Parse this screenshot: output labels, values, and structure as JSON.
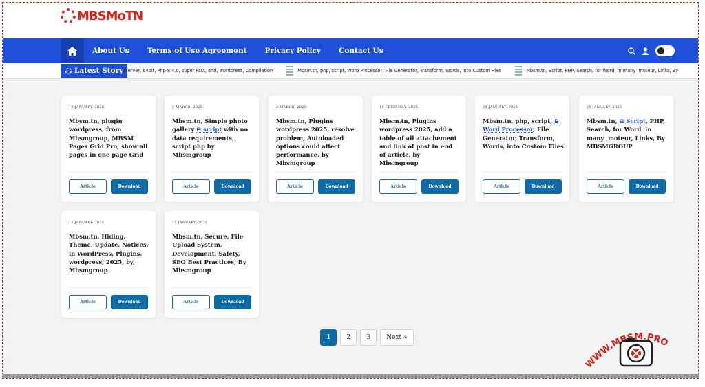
{
  "logo": {
    "text": "MBSMoTN"
  },
  "nav": {
    "links": [
      "About Us",
      "Terms of Use Agreement",
      "Privacy Policy",
      "Contact Us"
    ]
  },
  "ticker": {
    "label": "Latest Story",
    "items": [
      "pserver, 64bit, Php 8.4.0, super Fast, and, wordpress, Compilation",
      "Mbsm.tn, php, script, Word Processor, File Generator, Transform, Words, into Custom Files",
      "Mbsm.tn, Script, PHP, Search, for Word, in many ,moteur, Links, By MBSMGROUP"
    ]
  },
  "cards": [
    {
      "date": "19 JANUARY- 2026",
      "title": "Mbsm.tn, plugin wordpress, from Mbsmgroup, MBSM Pages Grid Pro, show all pages in one page Grid",
      "article": "Article",
      "download": "Download"
    },
    {
      "date": "2 MARCH- 2025",
      "title_a": "Mbsm.tn, Simple photo gallery ",
      "title_hl": "script",
      "title_b": " with no data requirements, script php by Mbsmgroup",
      "article": "Article",
      "download": "Download"
    },
    {
      "date": "2 MARCH- 2025",
      "title": "Mbsm.tn, Plugins wordpress 2025, resolve problem, Autoloaded options could affect performance, by Mbsmgroup",
      "article": "Article",
      "download": "Download"
    },
    {
      "date": "19 FEBRUARY- 2025",
      "title": "Mbsm.tn, Plugins wordpress 2025, add a table of all attachement and link of post in end of article, by Mbsmgroup",
      "article": "Article",
      "download": "Download"
    },
    {
      "date": "20 JANUARY- 2025",
      "title_a": "Mbsm.tn, php, script, ",
      "title_hl": "Word Processor",
      "title_b": ", File Generator, Transform, Words, into Custom Files",
      "article": "Article",
      "download": "Download"
    },
    {
      "date": "20 JANUARY- 2025",
      "title_a": "Mbsm.tn, ",
      "title_hl": "Script",
      "title_b": ", PHP, Search, for Word, in many ,moteur, Links, By MBSMGROUP",
      "article": "Article",
      "download": "Download"
    },
    {
      "date": "12 JANUARY- 2025",
      "title": "Mbsm.tn, Hiding, Theme, Update, Notices, in WordPress, Plugins, wordpress, 2025, by, Mbsmgroup",
      "article": "Article",
      "download": "Download"
    },
    {
      "date": "11 JANUARY- 2025",
      "title": "Mbsm.tn, Secure, File Upload System, Development, Safety, SEO Best Practices, By Mbsmgroup",
      "article": "Article",
      "download": "Download"
    }
  ],
  "pagination": {
    "pages": [
      "1",
      "2",
      "3"
    ],
    "next": "Next »",
    "active": "1"
  },
  "watermark": {
    "text": "WWW.MBSM.PRO"
  },
  "colors": {
    "nav": "#1d4fd8",
    "button": "#0f6ba6",
    "logo": "#d9231a"
  }
}
